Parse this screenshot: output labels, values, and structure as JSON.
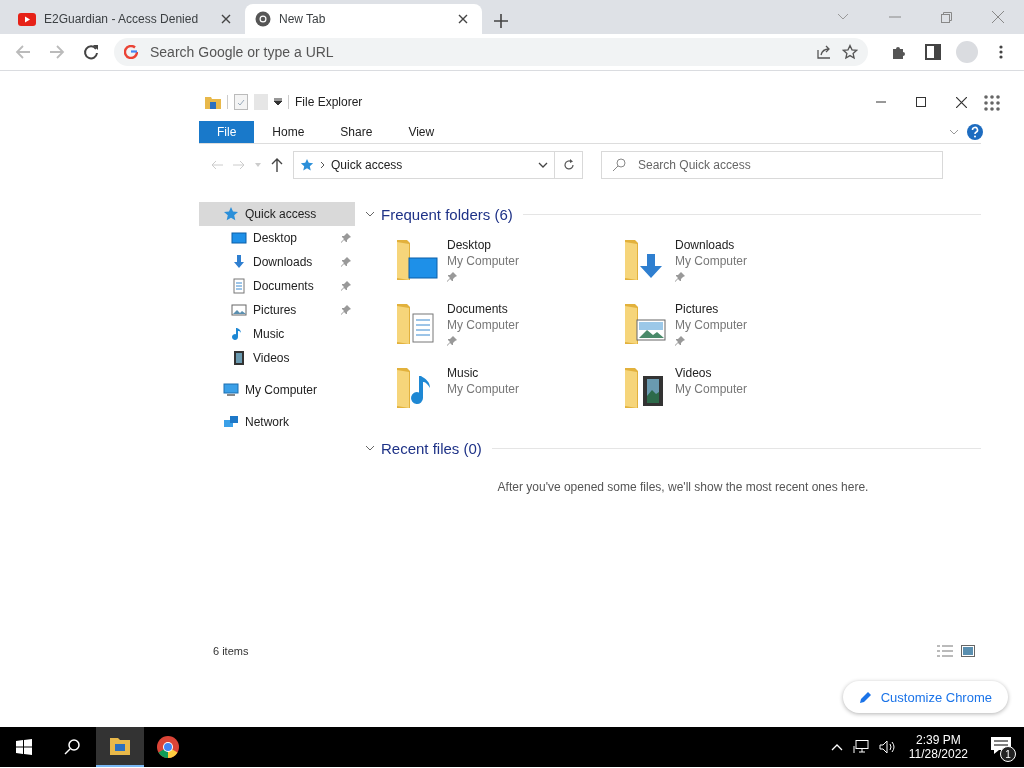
{
  "browser": {
    "tabs": [
      {
        "title": "E2Guardian - Access Denied",
        "kind": "youtube",
        "selected": false
      },
      {
        "title": "New Tab",
        "kind": "chrome",
        "selected": true
      }
    ],
    "omnibox": {
      "placeholder": "Search Google or type a URL"
    },
    "customize_button": "Customize Chrome"
  },
  "explorer": {
    "title": "File Explorer",
    "ribbon_tabs": [
      {
        "label": "File",
        "selected": true
      },
      {
        "label": "Home",
        "selected": false
      },
      {
        "label": "Share",
        "selected": false
      },
      {
        "label": "View",
        "selected": false
      }
    ],
    "address": "Quick access",
    "search": {
      "placeholder": "Search Quick access"
    },
    "sidebar": [
      {
        "label": "Quick access",
        "kind": "star",
        "selected": true,
        "children": [
          {
            "label": "Desktop",
            "kind": "desktop",
            "pinned": true
          },
          {
            "label": "Downloads",
            "kind": "downloads",
            "pinned": true
          },
          {
            "label": "Documents",
            "kind": "documents",
            "pinned": true
          },
          {
            "label": "Pictures",
            "kind": "pictures",
            "pinned": true
          },
          {
            "label": "Music",
            "kind": "music",
            "pinned": false
          },
          {
            "label": "Videos",
            "kind": "videos",
            "pinned": false
          }
        ]
      },
      {
        "label": "My Computer",
        "kind": "computer",
        "selected": false
      },
      {
        "label": "Network",
        "kind": "network",
        "selected": false
      }
    ],
    "frequent": {
      "title": "Frequent folders (6)",
      "folders": [
        {
          "name": "Desktop",
          "location": "My Computer",
          "kind": "desktop",
          "pinned": true
        },
        {
          "name": "Downloads",
          "location": "My Computer",
          "kind": "downloads",
          "pinned": true
        },
        {
          "name": "Documents",
          "location": "My Computer",
          "kind": "documents",
          "pinned": true
        },
        {
          "name": "Pictures",
          "location": "My Computer",
          "kind": "pictures",
          "pinned": true
        },
        {
          "name": "Music",
          "location": "My Computer",
          "kind": "music",
          "pinned": false
        },
        {
          "name": "Videos",
          "location": "My Computer",
          "kind": "videos",
          "pinned": false
        }
      ]
    },
    "recent": {
      "title": "Recent files (0)",
      "message": "After you've opened some files, we'll show the most recent ones here."
    },
    "status": "6 items"
  },
  "taskbar": {
    "time": "2:39 PM",
    "date": "11/28/2022",
    "notifications": "1"
  }
}
